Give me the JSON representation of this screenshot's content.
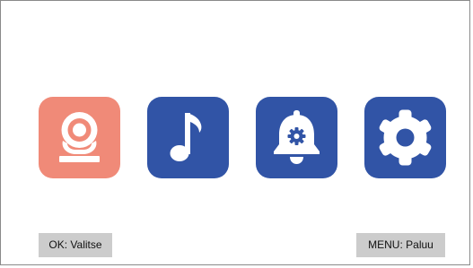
{
  "menu": {
    "items": [
      {
        "id": "camera",
        "icon": "camera-icon",
        "color": "#f08a78",
        "selected": true
      },
      {
        "id": "music",
        "icon": "music-note-icon",
        "color": "#3154a6",
        "selected": false
      },
      {
        "id": "alarm",
        "icon": "bell-gear-icon",
        "color": "#3154a6",
        "selected": false
      },
      {
        "id": "settings",
        "icon": "gear-icon",
        "color": "#3154a6",
        "selected": false
      }
    ]
  },
  "footer": {
    "ok_hint": "OK: Valitse",
    "menu_hint": "MENU: Paluu"
  },
  "colors": {
    "selected": "#f08a78",
    "unselected": "#3154a6",
    "hint_bg": "#cccccc",
    "background": "#ffffff"
  }
}
